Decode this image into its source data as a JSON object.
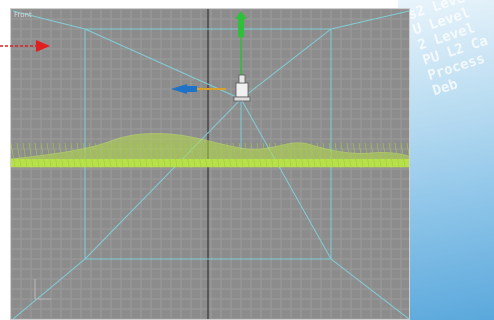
{
  "viewport": {
    "label": "Front"
  },
  "background": {
    "code_text": "s2 Level\nU Level\n2 Level\nPU L2 Ca\nProcess\nDeb"
  },
  "colors": {
    "viewport_bg": "#8c8c8c",
    "grid": "#9e9e9e",
    "camera_frustum": "#7fd6e0",
    "terrain": "#b8e04a",
    "axis_y": "#2fbf3a",
    "axis_x": "#1e73c8",
    "callout_arrow": "#e02020"
  },
  "icons": [
    "camera-icon",
    "gizmo-y-arrow-icon",
    "gizmo-x-arrow-icon",
    "callout-arrow-icon"
  ]
}
